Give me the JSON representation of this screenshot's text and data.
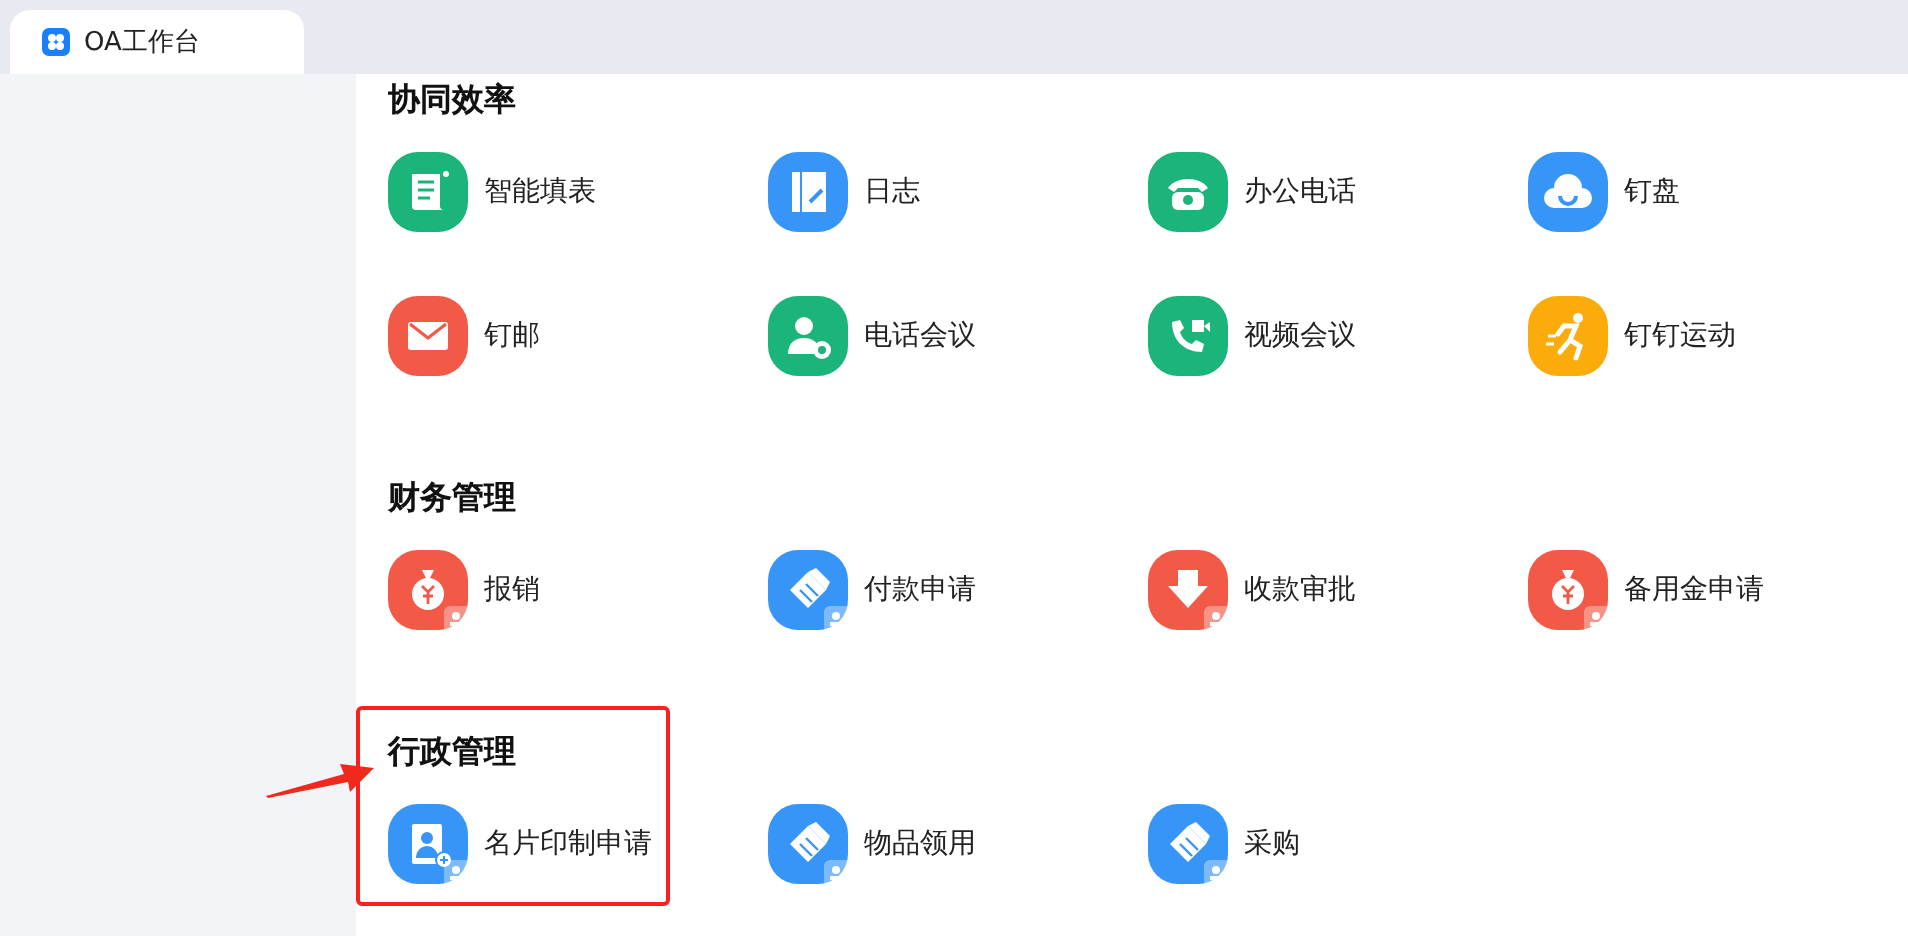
{
  "tab": {
    "title": "OA工作台",
    "selected": true
  },
  "sections": [
    {
      "title": "协同效率",
      "highlighted": false,
      "apps": [
        {
          "label": "智能填表",
          "kind": "form",
          "color": "#1bb47a",
          "badge": false
        },
        {
          "label": "日志",
          "kind": "notebook",
          "color": "#3895f8",
          "badge": false
        },
        {
          "label": "办公电话",
          "kind": "phone",
          "color": "#1bb47a",
          "badge": false
        },
        {
          "label": "钉盘",
          "kind": "cloud",
          "color": "#3895f8",
          "badge": false
        },
        {
          "label": "钉邮",
          "kind": "mail",
          "color": "#f25a47",
          "badge": false
        },
        {
          "label": "电话会议",
          "kind": "contact",
          "color": "#1bb47a",
          "badge": false
        },
        {
          "label": "视频会议",
          "kind": "video",
          "color": "#1bb47a",
          "badge": false
        },
        {
          "label": "钉钉运动",
          "kind": "runner",
          "color": "#fbab0a",
          "badge": false
        }
      ]
    },
    {
      "title": "财务管理",
      "highlighted": false,
      "apps": [
        {
          "label": "报销",
          "kind": "moneybag",
          "color": "#f25a47",
          "badge": true
        },
        {
          "label": "付款申请",
          "kind": "handshake",
          "color": "#3895f8",
          "badge": true
        },
        {
          "label": "收款审批",
          "kind": "down",
          "color": "#f25a47",
          "badge": true
        },
        {
          "label": "备用金申请",
          "kind": "moneybag",
          "color": "#f25a47",
          "badge": true
        }
      ]
    },
    {
      "title": "行政管理",
      "highlighted": true,
      "apps": [
        {
          "label": "名片印制申请",
          "kind": "card",
          "color": "#3895f8",
          "badge": true
        },
        {
          "label": "物品领用",
          "kind": "handshake",
          "color": "#3895f8",
          "badge": true
        },
        {
          "label": "采购",
          "kind": "handshake",
          "color": "#3895f8",
          "badge": true
        }
      ]
    }
  ]
}
